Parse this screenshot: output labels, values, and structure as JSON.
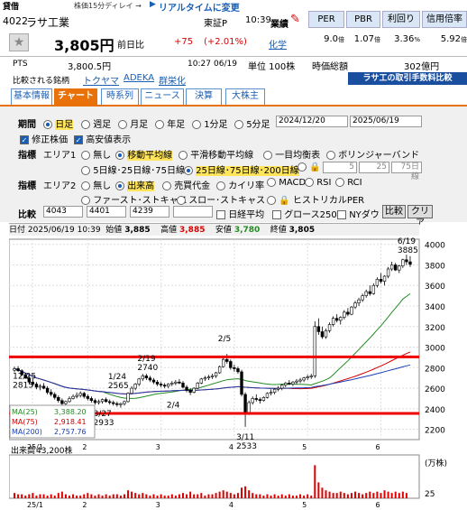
{
  "header": {
    "tag": "貸借",
    "delay_note": "株価15分ディレイ →",
    "realtime_arrow": "▶",
    "realtime_link": "リアルタイムに変更",
    "code": "4022",
    "name": "ラサ工業",
    "market": "東証P",
    "time": "10:39",
    "gyoseki": "業績",
    "price": "3,805円",
    "prev_label": "前日比",
    "change": "+75",
    "change_pct": "(+2.01%)",
    "industry": "化学",
    "pts_label": "PTS",
    "pts_value": "3,800.5円",
    "pts_time": "10:27",
    "pts_date": "06/19",
    "unit": "単位 100株",
    "market_cap_label": "時価総額",
    "market_cap_value": "302億円",
    "compare_label": "比較される銘柄",
    "compare": [
      "トクヤマ",
      "ADEKA",
      "群栄化"
    ],
    "banner": "ラサ工の取引手数料比較"
  },
  "metrics": [
    {
      "label": "PER",
      "value": "9.0",
      "unit": "倍"
    },
    {
      "label": "PBR",
      "value": "1.07",
      "unit": "倍"
    },
    {
      "label": "利回り",
      "value": "3.36",
      "unit": "%"
    },
    {
      "label": "信用倍率",
      "value": "5.92",
      "unit": "倍"
    }
  ],
  "tabs": [
    "基本情報",
    "チャート",
    "時系列",
    "ニュース",
    "決算",
    "大株主"
  ],
  "controls": {
    "period_label": "期間",
    "periods": [
      "日足",
      "週足",
      "月足",
      "年足",
      "1分足",
      "5分足"
    ],
    "date_from": "2024/12/20",
    "date_to": "2025/06/19",
    "adjusted": "修正株価",
    "high_res": "高安値表示",
    "indicator_label": "指標",
    "area1": "エリア1",
    "area1_opts": [
      "無し",
      "移動平均線",
      "平滑移動平均線",
      "一目均衡表",
      "ボリンジャーバンド"
    ],
    "ma_opts": [
      "5日線･25日線･75日線",
      "25日線･75日線･200日線"
    ],
    "ma_inputs": [
      "5",
      "25",
      "75日線"
    ],
    "area2": "エリア2",
    "area2_opts": [
      "無し",
      "出来高",
      "売買代金",
      "カイリ率",
      "MACD",
      "RSI",
      "RCI"
    ],
    "area2_opts2": [
      "ファースト･ストキャス",
      "スロー･ストキャス",
      "ヒストリカルPER"
    ],
    "compare_label": "比較",
    "compare_inputs": [
      "4043",
      "4401",
      "4239",
      ""
    ],
    "nikkei": "日経平均",
    "growth": "グロース250",
    "nydow": "NYダウ",
    "compare_btn": "比較",
    "clear_btn": "クリア"
  },
  "infobar": {
    "label": "日付",
    "date": "2025/06/19 10:39",
    "open_l": "始値",
    "open": "3,885",
    "high_l": "高値",
    "high": "3,885",
    "low_l": "安値",
    "low": "3,780",
    "close_l": "終値",
    "close": "3,805"
  },
  "chart_data": {
    "type": "candlestick",
    "y_ticks": [
      "4000",
      "3800",
      "3600",
      "3400",
      "3200",
      "3000",
      "2800",
      "2600",
      "2400",
      "2200"
    ],
    "x_ticks": [
      "25/1",
      "2",
      "3",
      "4",
      "5",
      "6"
    ],
    "legend": [
      {
        "label": "MA(25)",
        "value": "3,388.20",
        "color": "#228b22"
      },
      {
        "label": "MA(75)",
        "value": "2,918.41",
        "color": "#d00000"
      },
      {
        "label": "MA(200)",
        "value": "2,757.76",
        "color": "#1a3fb4"
      }
    ],
    "annotations": [
      {
        "date": "12/25",
        "value": "2815"
      },
      {
        "date": "1/24",
        "value": "2565"
      },
      {
        "date": "2/4",
        "value": ""
      },
      {
        "date": "2/19",
        "value": "2740"
      },
      {
        "date": "2/5",
        "value": ""
      },
      {
        "date": "3/11",
        "value": "2533"
      },
      {
        "date": "3/27",
        "value": "2933"
      },
      {
        "date": "4/7",
        "value": "2224"
      },
      {
        "date": "6/19",
        "value": "3885"
      }
    ],
    "volume_label": "出来高",
    "volume_value": "43,200株",
    "volume_unit": "(万株)",
    "volume_tick": "25",
    "h_lines": [
      2905,
      2355
    ],
    "ohlc": [
      [
        2775,
        2810,
        2755,
        2790
      ],
      [
        2790,
        2815,
        2760,
        2770
      ],
      [
        2770,
        2785,
        2720,
        2730
      ],
      [
        2730,
        2750,
        2690,
        2700
      ],
      [
        2700,
        2720,
        2640,
        2660
      ],
      [
        2660,
        2690,
        2620,
        2640
      ],
      [
        2640,
        2660,
        2590,
        2610
      ],
      [
        2610,
        2640,
        2580,
        2620
      ],
      [
        2620,
        2650,
        2590,
        2600
      ],
      [
        2600,
        2620,
        2540,
        2560
      ],
      [
        2560,
        2590,
        2520,
        2540
      ],
      [
        2540,
        2560,
        2490,
        2510
      ],
      [
        2510,
        2530,
        2460,
        2480
      ],
      [
        2480,
        2500,
        2430,
        2450
      ],
      [
        2450,
        2480,
        2420,
        2470
      ],
      [
        2470,
        2520,
        2460,
        2500
      ],
      [
        2500,
        2540,
        2490,
        2520
      ],
      [
        2520,
        2560,
        2500,
        2530
      ],
      [
        2530,
        2570,
        2510,
        2550
      ],
      [
        2550,
        2565,
        2500,
        2520
      ],
      [
        2520,
        2540,
        2480,
        2500
      ],
      [
        2500,
        2520,
        2460,
        2480
      ],
      [
        2480,
        2500,
        2440,
        2460
      ],
      [
        2460,
        2490,
        2440,
        2470
      ],
      [
        2470,
        2500,
        2450,
        2490
      ],
      [
        2490,
        2510,
        2460,
        2470
      ],
      [
        2470,
        2490,
        2440,
        2460
      ],
      [
        2460,
        2480,
        2430,
        2450
      ],
      [
        2450,
        2470,
        2420,
        2440
      ],
      [
        2440,
        2460,
        2410,
        2450
      ],
      [
        2450,
        2480,
        2430,
        2470
      ],
      [
        2470,
        2560,
        2460,
        2550
      ],
      [
        2550,
        2620,
        2540,
        2600
      ],
      [
        2600,
        2650,
        2580,
        2640
      ],
      [
        2640,
        2700,
        2620,
        2690
      ],
      [
        2690,
        2740,
        2670,
        2720
      ],
      [
        2720,
        2740,
        2680,
        2700
      ],
      [
        2700,
        2720,
        2660,
        2680
      ],
      [
        2680,
        2700,
        2640,
        2660
      ],
      [
        2660,
        2680,
        2620,
        2640
      ],
      [
        2640,
        2660,
        2610,
        2630
      ],
      [
        2630,
        2650,
        2600,
        2620
      ],
      [
        2620,
        2650,
        2600,
        2640
      ],
      [
        2640,
        2670,
        2620,
        2650
      ],
      [
        2650,
        2680,
        2630,
        2660
      ],
      [
        2660,
        2690,
        2640,
        2650
      ],
      [
        2650,
        2670,
        2600,
        2610
      ],
      [
        2610,
        2630,
        2560,
        2580
      ],
      [
        2580,
        2600,
        2533,
        2560
      ],
      [
        2560,
        2610,
        2550,
        2600
      ],
      [
        2600,
        2660,
        2590,
        2650
      ],
      [
        2650,
        2700,
        2640,
        2690
      ],
      [
        2690,
        2720,
        2670,
        2700
      ],
      [
        2700,
        2730,
        2680,
        2710
      ],
      [
        2710,
        2740,
        2690,
        2720
      ],
      [
        2720,
        2760,
        2700,
        2750
      ],
      [
        2750,
        2820,
        2740,
        2810
      ],
      [
        2810,
        2900,
        2800,
        2880
      ],
      [
        2880,
        2933,
        2840,
        2860
      ],
      [
        2860,
        2880,
        2780,
        2800
      ],
      [
        2800,
        2830,
        2760,
        2790
      ],
      [
        2790,
        2810,
        2740,
        2760
      ],
      [
        2760,
        2780,
        2520,
        2540
      ],
      [
        2540,
        2560,
        2224,
        2360
      ],
      [
        2360,
        2480,
        2340,
        2460
      ],
      [
        2460,
        2520,
        2440,
        2500
      ],
      [
        2500,
        2540,
        2470,
        2490
      ],
      [
        2490,
        2510,
        2450,
        2480
      ],
      [
        2480,
        2520,
        2470,
        2510
      ],
      [
        2510,
        2560,
        2500,
        2550
      ],
      [
        2550,
        2590,
        2530,
        2560
      ],
      [
        2560,
        2600,
        2540,
        2590
      ],
      [
        2590,
        2620,
        2570,
        2600
      ],
      [
        2600,
        2640,
        2580,
        2630
      ],
      [
        2630,
        2660,
        2610,
        2650
      ],
      [
        2650,
        2680,
        2630,
        2640
      ],
      [
        2640,
        2670,
        2620,
        2660
      ],
      [
        2660,
        2690,
        2640,
        2670
      ],
      [
        2670,
        2700,
        2650,
        2680
      ],
      [
        2680,
        2710,
        2660,
        2700
      ],
      [
        2700,
        2730,
        2680,
        2710
      ],
      [
        2710,
        2740,
        2690,
        2720
      ],
      [
        2720,
        3250,
        2700,
        3200
      ],
      [
        3200,
        3280,
        3120,
        3150
      ],
      [
        3150,
        3200,
        3080,
        3100
      ],
      [
        3100,
        3180,
        3080,
        3160
      ],
      [
        3160,
        3240,
        3140,
        3220
      ],
      [
        3220,
        3300,
        3200,
        3280
      ],
      [
        3280,
        3320,
        3240,
        3260
      ],
      [
        3260,
        3300,
        3220,
        3290
      ],
      [
        3290,
        3360,
        3270,
        3340
      ],
      [
        3340,
        3380,
        3300,
        3320
      ],
      [
        3320,
        3400,
        3310,
        3390
      ],
      [
        3390,
        3450,
        3370,
        3430
      ],
      [
        3430,
        3480,
        3400,
        3460
      ],
      [
        3460,
        3520,
        3440,
        3500
      ],
      [
        3500,
        3560,
        3480,
        3540
      ],
      [
        3540,
        3600,
        3500,
        3520
      ],
      [
        3520,
        3620,
        3510,
        3600
      ],
      [
        3600,
        3680,
        3580,
        3660
      ],
      [
        3660,
        3720,
        3620,
        3640
      ],
      [
        3640,
        3700,
        3600,
        3690
      ],
      [
        3690,
        3780,
        3670,
        3760
      ],
      [
        3760,
        3830,
        3740,
        3800
      ],
      [
        3800,
        3820,
        3740,
        3750
      ],
      [
        3750,
        3800,
        3720,
        3790
      ],
      [
        3790,
        3860,
        3770,
        3850
      ],
      [
        3850,
        3900,
        3800,
        3830
      ],
      [
        3830,
        3885,
        3780,
        3805
      ]
    ],
    "volume": [
      4,
      3,
      3,
      2,
      3,
      4,
      2,
      3,
      3,
      2,
      3,
      2,
      4,
      5,
      3,
      2,
      3,
      2,
      2,
      3,
      4,
      3,
      2,
      3,
      2,
      3,
      2,
      3,
      3,
      2,
      3,
      6,
      5,
      4,
      3,
      4,
      3,
      2,
      3,
      2,
      3,
      2,
      2,
      3,
      2,
      3,
      4,
      3,
      5,
      3,
      3,
      4,
      2,
      3,
      3,
      4,
      5,
      6,
      5,
      4,
      3,
      4,
      8,
      9,
      6,
      4,
      3,
      3,
      2,
      3,
      2,
      3,
      2,
      3,
      2,
      3,
      2,
      2,
      3,
      2,
      3,
      2,
      25,
      12,
      8,
      6,
      5,
      4,
      4,
      5,
      4,
      3,
      4,
      5,
      4,
      3,
      4,
      5,
      4,
      5,
      4,
      6,
      5,
      4,
      5,
      4,
      5,
      4
    ]
  }
}
